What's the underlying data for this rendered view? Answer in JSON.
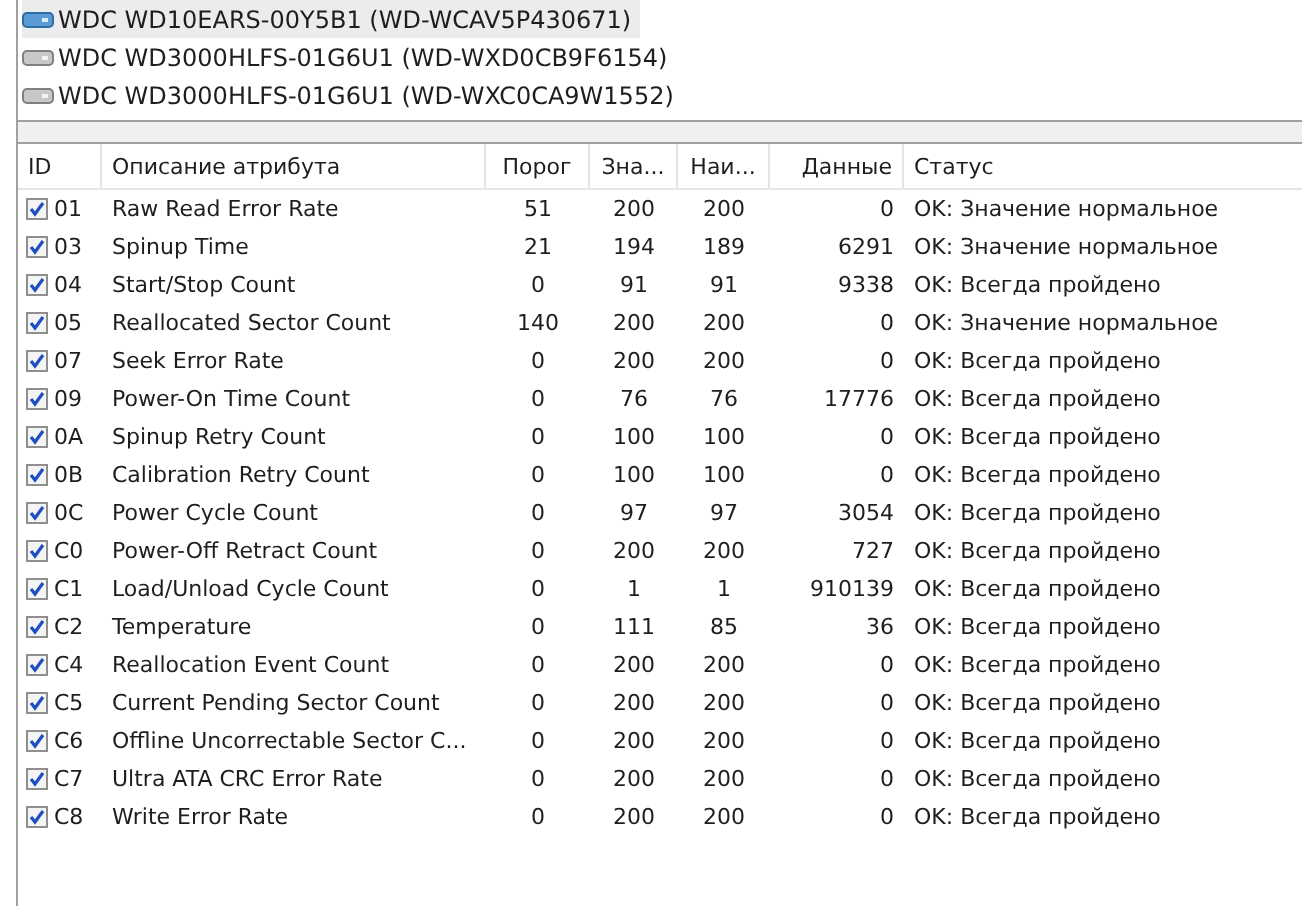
{
  "drives": [
    {
      "label": "WDC WD10EARS-00Y5B1 (WD-WCAV5P430671)",
      "selected": true
    },
    {
      "label": "WDC WD3000HLFS-01G6U1 (WD-WXD0CB9F6154)",
      "selected": false
    },
    {
      "label": "WDC WD3000HLFS-01G6U1 (WD-WXC0CA9W1552)",
      "selected": false
    }
  ],
  "table": {
    "columns": [
      "ID",
      "Описание атрибута",
      "Порог",
      "Зна...",
      "Наи...",
      "Данные",
      "Статус"
    ],
    "rows": [
      {
        "checked": true,
        "cells": [
          "01",
          "Raw Read Error Rate",
          "51",
          "200",
          "200",
          "0",
          "OK: Значение нормальное"
        ]
      },
      {
        "checked": true,
        "cells": [
          "03",
          "Spinup Time",
          "21",
          "194",
          "189",
          "6291",
          "OK: Значение нормальное"
        ]
      },
      {
        "checked": true,
        "cells": [
          "04",
          "Start/Stop Count",
          "0",
          "91",
          "91",
          "9338",
          "OK: Всегда пройдено"
        ]
      },
      {
        "checked": true,
        "cells": [
          "05",
          "Reallocated Sector Count",
          "140",
          "200",
          "200",
          "0",
          "OK: Значение нормальное"
        ]
      },
      {
        "checked": true,
        "cells": [
          "07",
          "Seek Error Rate",
          "0",
          "200",
          "200",
          "0",
          "OK: Всегда пройдено"
        ]
      },
      {
        "checked": true,
        "cells": [
          "09",
          "Power-On Time Count",
          "0",
          "76",
          "76",
          "17776",
          "OK: Всегда пройдено"
        ]
      },
      {
        "checked": true,
        "cells": [
          "0A",
          "Spinup Retry Count",
          "0",
          "100",
          "100",
          "0",
          "OK: Всегда пройдено"
        ]
      },
      {
        "checked": true,
        "cells": [
          "0B",
          "Calibration Retry Count",
          "0",
          "100",
          "100",
          "0",
          "OK: Всегда пройдено"
        ]
      },
      {
        "checked": true,
        "cells": [
          "0C",
          "Power Cycle Count",
          "0",
          "97",
          "97",
          "3054",
          "OK: Всегда пройдено"
        ]
      },
      {
        "checked": true,
        "cells": [
          "C0",
          "Power-Off Retract Count",
          "0",
          "200",
          "200",
          "727",
          "OK: Всегда пройдено"
        ]
      },
      {
        "checked": true,
        "cells": [
          "C1",
          "Load/Unload Cycle Count",
          "0",
          "1",
          "1",
          "910139",
          "OK: Всегда пройдено"
        ]
      },
      {
        "checked": true,
        "cells": [
          "C2",
          "Temperature",
          "0",
          "111",
          "85",
          "36",
          "OK: Всегда пройдено"
        ]
      },
      {
        "checked": true,
        "cells": [
          "C4",
          "Reallocation Event Count",
          "0",
          "200",
          "200",
          "0",
          "OK: Всегда пройдено"
        ]
      },
      {
        "checked": true,
        "cells": [
          "C5",
          "Current Pending Sector Count",
          "0",
          "200",
          "200",
          "0",
          "OK: Всегда пройдено"
        ]
      },
      {
        "checked": true,
        "cells": [
          "C6",
          "Offline Uncorrectable Sector C...",
          "0",
          "200",
          "200",
          "0",
          "OK: Всегда пройдено"
        ]
      },
      {
        "checked": true,
        "cells": [
          "C7",
          "Ultra ATA CRC Error Rate",
          "0",
          "200",
          "200",
          "0",
          "OK: Всегда пройдено"
        ]
      },
      {
        "checked": true,
        "cells": [
          "C8",
          "Write Error Rate",
          "0",
          "200",
          "200",
          "0",
          "OK: Всегда пройдено"
        ]
      }
    ]
  }
}
